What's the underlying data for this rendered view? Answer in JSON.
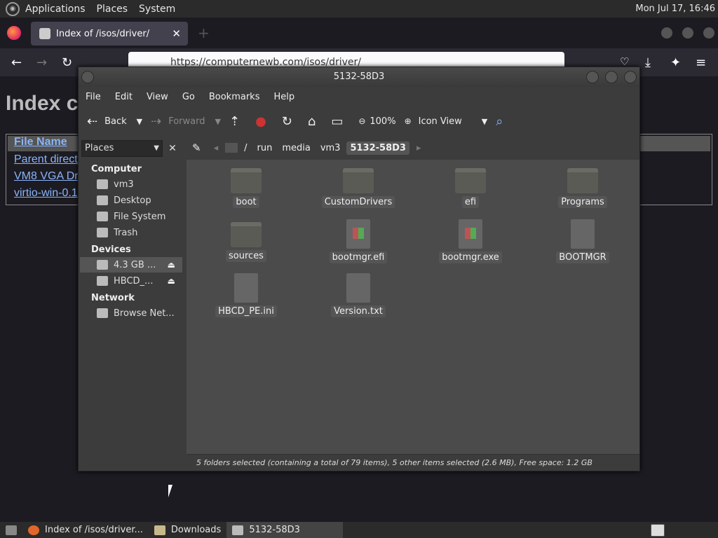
{
  "top_panel": {
    "menus": [
      "Applications",
      "Places",
      "System"
    ],
    "clock": "Mon Jul 17, 16:46"
  },
  "firefox": {
    "tab_title": "Index of /isos/driver/",
    "url": "https://computernewb.com/isos/driver/",
    "page_heading": "Index c",
    "table_header": "File Name",
    "rows": [
      "Parent directo",
      "VM8 VGA Dr",
      "virtio-win-0.1"
    ]
  },
  "file_manager": {
    "title": "5132-58D3",
    "menu": [
      "File",
      "Edit",
      "View",
      "Go",
      "Bookmarks",
      "Help"
    ],
    "toolbar": {
      "back": "Back",
      "forward": "Forward",
      "zoom": "100%",
      "view_mode": "Icon View"
    },
    "sidebar": {
      "combo": "Places",
      "sections": [
        {
          "title": "Computer",
          "items": [
            "vm3",
            "Desktop",
            "File System",
            "Trash"
          ]
        },
        {
          "title": "Devices",
          "items": [
            "4.3 GB ...",
            "HBCD_..."
          ]
        },
        {
          "title": "Network",
          "items": [
            "Browse Net..."
          ]
        }
      ]
    },
    "path": [
      "/",
      "run",
      "media",
      "vm3",
      "5132-58D3"
    ],
    "items": [
      {
        "name": "boot",
        "kind": "folder"
      },
      {
        "name": "CustomDrivers",
        "kind": "folder"
      },
      {
        "name": "efi",
        "kind": "folder"
      },
      {
        "name": "Programs",
        "kind": "folder"
      },
      {
        "name": "sources",
        "kind": "folder"
      },
      {
        "name": "bootmgr.efi",
        "kind": "exe"
      },
      {
        "name": "bootmgr.exe",
        "kind": "exe"
      },
      {
        "name": "BOOTMGR",
        "kind": "file"
      },
      {
        "name": "HBCD_PE.ini",
        "kind": "file"
      },
      {
        "name": "Version.txt",
        "kind": "file"
      }
    ],
    "status": "5 folders selected (containing a total of 79 items), 5 other items selected (2.6 MB), Free space: 1.2 GB"
  },
  "taskbar": {
    "tasks": [
      "Index of /isos/driver...",
      "Downloads",
      "5132-58D3"
    ]
  }
}
